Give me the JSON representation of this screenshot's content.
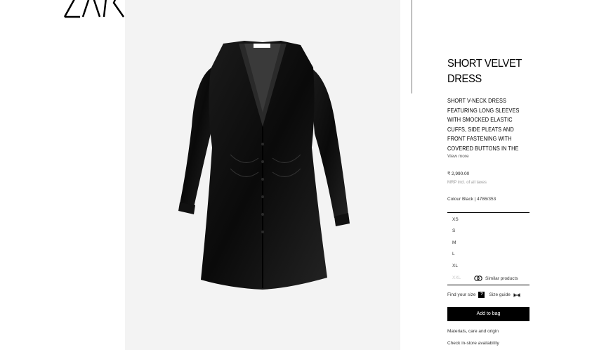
{
  "brand": {
    "logo_text": "ZARA"
  },
  "product": {
    "title": "SHORT VELVET DRESS",
    "description": "SHORT V-NECK DRESS FEATURING LONG SLEEVES WITH SMOCKED ELASTIC CUFFS, SIDE PLEATS AND FRONT FASTENING WITH COVERED BUTTONS IN THE",
    "view_more": "View more",
    "price": "₹ 2,990.00",
    "tax_note": "MRP incl. of all taxes",
    "colour_ref": "Colour Black | 4786/353"
  },
  "sizes": [
    {
      "label": "XS",
      "available": true
    },
    {
      "label": "S",
      "available": true
    },
    {
      "label": "M",
      "available": true
    },
    {
      "label": "L",
      "available": true
    },
    {
      "label": "XL",
      "available": true
    },
    {
      "label": "XXL",
      "available": false
    }
  ],
  "similar_products": "Similar products",
  "find_size": {
    "label": "Find your size",
    "icon_text": "?",
    "size_guide": "Size guide"
  },
  "add_to_bag": "Add to bag",
  "links": {
    "materials": "Materials, care and origin",
    "store": "Check in-store availability"
  },
  "icons": {
    "similar": "similar-products-icon",
    "size_guide": "ruler-icon",
    "find_size": "question-icon"
  }
}
